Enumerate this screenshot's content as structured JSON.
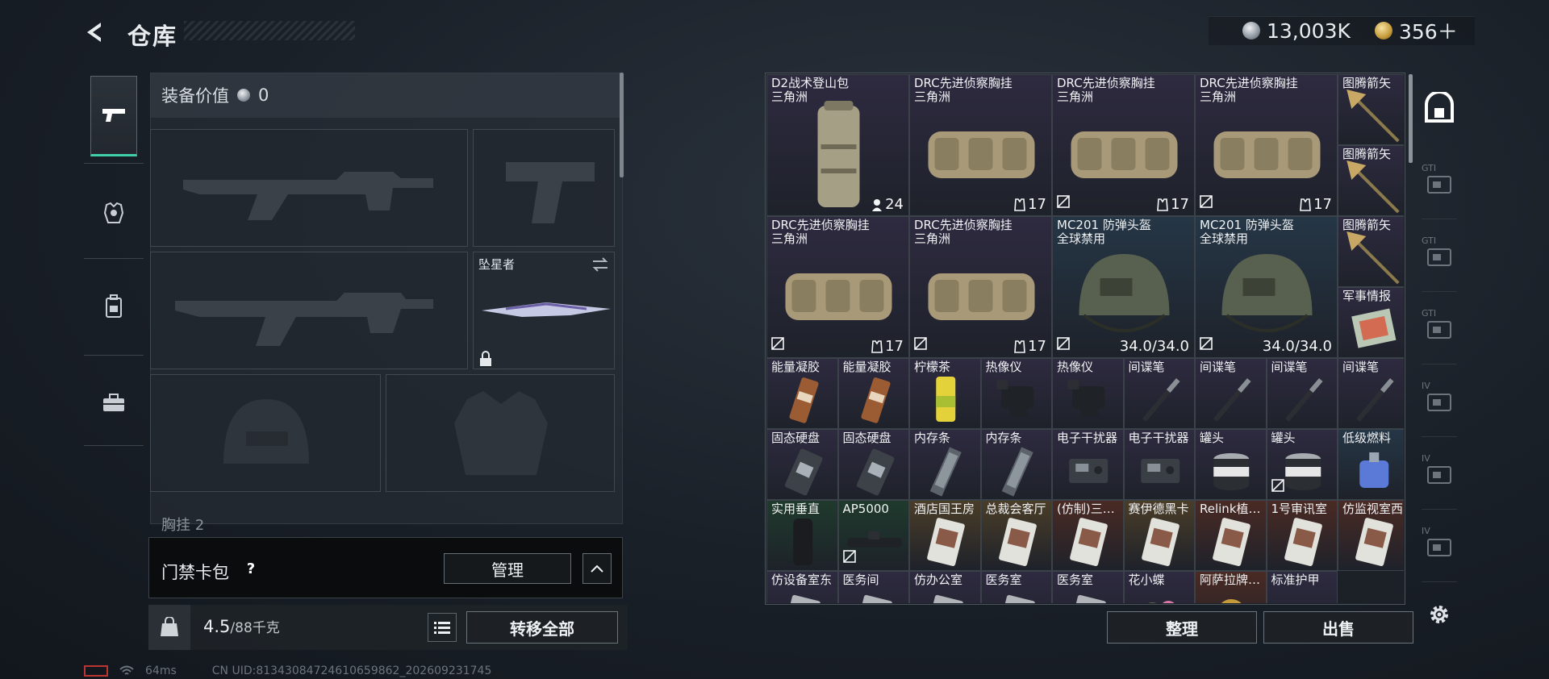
{
  "header": {
    "title": "仓库",
    "back_icon": "back-arrow-icon",
    "currency": [
      {
        "icon": "silver-coin-icon",
        "value": "13,003K"
      },
      {
        "icon": "gold-coin-icon",
        "value": "356＋"
      }
    ]
  },
  "left_tabs": [
    {
      "name": "weapon-tab",
      "icon": "pistol-icon",
      "active": true
    },
    {
      "name": "armor-tab",
      "icon": "armor-icon",
      "active": false
    },
    {
      "name": "backpack-tab",
      "icon": "backpack-icon",
      "active": false
    },
    {
      "name": "toolbox-tab",
      "icon": "toolbox-icon",
      "active": false
    }
  ],
  "equipment": {
    "value_label": "装备价值",
    "value": "0",
    "melee_label": "坠星者",
    "chest_label": "胸挂",
    "chest_count": "2"
  },
  "card_wallet": {
    "label": "门禁卡包",
    "help": "?",
    "manage_label": "管理"
  },
  "bottom": {
    "weight": "4.5",
    "weight_max": "/88千克",
    "transfer_all": "转移全部"
  },
  "footer": {
    "ping": "64ms",
    "uid": "CN UID:8134308472461065986​2_202609231745"
  },
  "storage": {
    "sort_label": "整理",
    "sell_label": "出售",
    "items": [
      {
        "name": "D2战术登山包",
        "sub": "三角洲",
        "badge": "24",
        "badge_icon": "person-icon"
      },
      {
        "name": "DRC先进侦察胸挂",
        "sub": "三角洲",
        "badge": "17",
        "badge_icon": "vest-icon"
      },
      {
        "name": "DRC先进侦察胸挂",
        "sub": "三角洲",
        "badge": "17",
        "badge_icon": "vest-icon"
      },
      {
        "name": "DRC先进侦察胸挂",
        "sub": "三角洲",
        "badge": "17",
        "badge_icon": "vest-icon"
      },
      {
        "name": "图腾箭矢"
      },
      {
        "name": "图腾箭矢"
      },
      {
        "name": "DRC先进侦察胸挂",
        "sub": "三角洲",
        "badge": "17",
        "badge_icon": "vest-icon"
      },
      {
        "name": "DRC先进侦察胸挂",
        "sub": "三角洲",
        "badge": "17",
        "badge_icon": "vest-icon"
      },
      {
        "name": "MC201 防弹头盔",
        "sub": "全球禁用",
        "badge": "34.0/34.0"
      },
      {
        "name": "MC201 防弹头盔",
        "sub": "全球禁用",
        "badge": "34.0/34.0"
      },
      {
        "name": "图腾箭矢"
      },
      {
        "name": "军事情报"
      },
      {
        "name": "能量凝胶"
      },
      {
        "name": "能量凝胶"
      },
      {
        "name": "柠檬茶"
      },
      {
        "name": "热像仪"
      },
      {
        "name": "热像仪"
      },
      {
        "name": "间谍笔"
      },
      {
        "name": "间谍笔"
      },
      {
        "name": "间谍笔"
      },
      {
        "name": "间谍笔"
      },
      {
        "name": "固态硬盘"
      },
      {
        "name": "固态硬盘"
      },
      {
        "name": "内存条"
      },
      {
        "name": "内存条"
      },
      {
        "name": "电子干扰器"
      },
      {
        "name": "电子干扰器"
      },
      {
        "name": "罐头"
      },
      {
        "name": "罐头"
      },
      {
        "name": "低级燃料"
      },
      {
        "name": "实用垂直"
      },
      {
        "name": "AP5000"
      },
      {
        "name": "酒店国王房"
      },
      {
        "name": "总裁会客厅"
      },
      {
        "name": "(仿制)三…"
      },
      {
        "name": "赛伊德黑卡"
      },
      {
        "name": "Relink植…"
      },
      {
        "name": "1号审讯室"
      },
      {
        "name": "仿监视室西"
      },
      {
        "name": "仿设备室东"
      },
      {
        "name": "医务间"
      },
      {
        "name": "仿办公室"
      },
      {
        "name": "医务室"
      },
      {
        "name": "医务室"
      },
      {
        "name": "花小蝶"
      },
      {
        "name": "阿萨拉牌…"
      },
      {
        "name": "标准护甲"
      }
    ]
  },
  "right_tabs": [
    {
      "name": "storage-home-tab",
      "icon": "safe-icon",
      "active": true
    },
    {
      "name": "tab-gti-1",
      "label": "GTI",
      "icon": "gti-icon"
    },
    {
      "name": "tab-gti-2",
      "label": "GTI",
      "icon": "gti-icon"
    },
    {
      "name": "tab-gti-3",
      "label": "GTI",
      "icon": "gti-icon"
    },
    {
      "name": "tab-iv-1",
      "label": "IV",
      "icon": "iv-icon"
    },
    {
      "name": "tab-iv-2",
      "label": "IV",
      "icon": "iv-icon"
    },
    {
      "name": "tab-iv-3",
      "label": "IV",
      "icon": "iv-icon"
    }
  ],
  "colors": {
    "accent_teal": "#3fcfaa",
    "cell_gold": "#4a3d28",
    "cell_green": "#1f3a2c",
    "cell_red": "#4a2a24",
    "cell_blue": "#253646",
    "cell_purple": "#2e2a40"
  }
}
